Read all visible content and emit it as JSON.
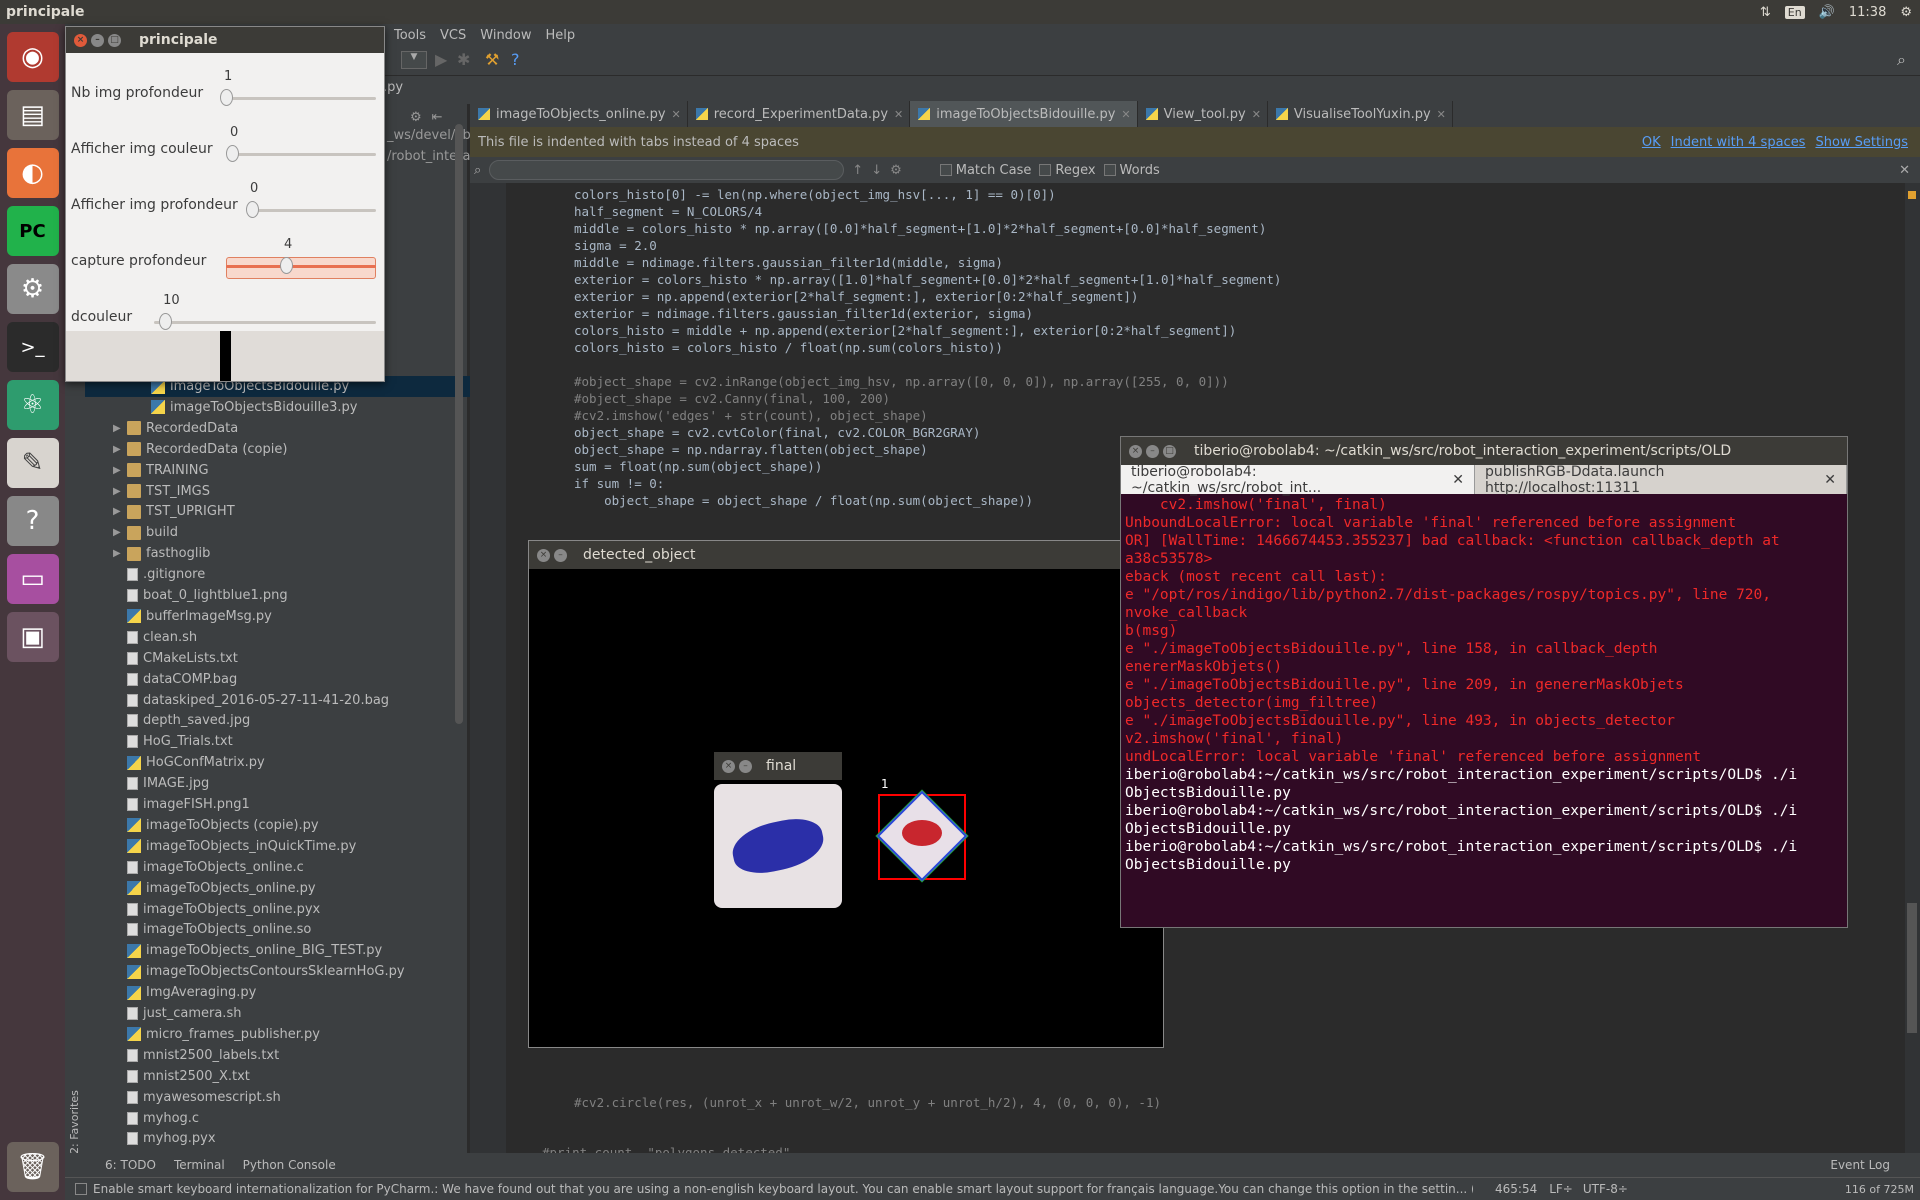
{
  "top_panel": {
    "title": "principale",
    "lang": "En",
    "time": "11:38"
  },
  "menubar": {
    "items": [
      "Tools",
      "VCS",
      "Window",
      "Help"
    ]
  },
  "navbar": {
    "crumb_file": ".py",
    "crumb_path1": "_ws/devel/lib",
    "crumb_path2": "/robot_intera"
  },
  "editor_tabs": [
    {
      "label": "imageToObjects_online.py",
      "active": false
    },
    {
      "label": "record_ExperimentData.py",
      "active": false
    },
    {
      "label": "imageToObjectsBidouille.py",
      "active": true
    },
    {
      "label": "View_tool.py",
      "active": false
    },
    {
      "label": "VisualiseToolYuxin.py",
      "active": false
    }
  ],
  "notice": {
    "text": "This file is indented with tabs instead of 4 spaces",
    "ok": "OK",
    "indent": "Indent with 4 spaces",
    "settings": "Show Settings"
  },
  "search": {
    "match_case": "Match Case",
    "regex": "Regex",
    "words": "Words"
  },
  "code_lines": [
    {
      "text": "colors_histo[0] -= len(np.where(object_img_hsv[..., 1] == 0)[0])",
      "cm": false
    },
    {
      "text": "half_segment = N_COLORS/4",
      "cm": false
    },
    {
      "text": "middle = colors_histo * np.array([0.0]*half_segment+[1.0]*2*half_segment+[0.0]*half_segment)",
      "cm": false
    },
    {
      "text": "sigma = 2.0",
      "cm": false
    },
    {
      "text": "middle = ndimage.filters.gaussian_filter1d(middle, sigma)",
      "cm": false
    },
    {
      "text": "exterior = colors_histo * np.array([1.0]*half_segment+[0.0]*2*half_segment+[1.0]*half_segment)",
      "cm": false
    },
    {
      "text": "exterior = np.append(exterior[2*half_segment:], exterior[0:2*half_segment])",
      "cm": false
    },
    {
      "text": "exterior = ndimage.filters.gaussian_filter1d(exterior, sigma)",
      "cm": false
    },
    {
      "text": "colors_histo = middle + np.append(exterior[2*half_segment:], exterior[0:2*half_segment])",
      "cm": false
    },
    {
      "text": "colors_histo = colors_histo / float(np.sum(colors_histo))",
      "cm": false
    },
    {
      "text": "",
      "cm": false
    },
    {
      "text": "#object_shape = cv2.inRange(object_img_hsv, np.array([0, 0, 0]), np.array([255, 0, 0]))",
      "cm": true
    },
    {
      "text": "#object_shape = cv2.Canny(final, 100, 200)",
      "cm": true
    },
    {
      "text": "#cv2.imshow('edges' + str(count), object_shape)",
      "cm": true
    },
    {
      "text": "object_shape = cv2.cvtColor(final, cv2.COLOR_BGR2GRAY)",
      "cm": false
    },
    {
      "text": "object_shape = np.ndarray.flatten(object_shape)",
      "cm": false
    },
    {
      "text": "sum = float(np.sum(object_shape))",
      "cm": false
    },
    {
      "text": "if sum != 0:",
      "cm": false
    },
    {
      "text": "    object_shape = object_shape / float(np.sum(object_shape))",
      "cm": false
    }
  ],
  "code_bottom": {
    "line1": "#cv2.circle(res, (unrot_x + unrot_w/2, unrot_y + unrot_h/2), 4, (0, 0, 0), -1)",
    "line2": "#print count, \"polygons detected\""
  },
  "project_tree": [
    {
      "label": "imageToObjectsBidouille.py",
      "type": "py",
      "indent": 2,
      "selected": true
    },
    {
      "label": "imageToObjectsBidouille3.py",
      "type": "py",
      "indent": 2
    },
    {
      "label": "RecordedData",
      "type": "dir",
      "indent": 1
    },
    {
      "label": "RecordedData (copie)",
      "type": "dir",
      "indent": 1
    },
    {
      "label": "TRAINING",
      "type": "dir",
      "indent": 1
    },
    {
      "label": "TST_IMGS",
      "type": "dir",
      "indent": 1
    },
    {
      "label": "TST_UPRIGHT",
      "type": "dir",
      "indent": 1
    },
    {
      "label": "build",
      "type": "dir",
      "indent": 1
    },
    {
      "label": "fasthoglib",
      "type": "dir",
      "indent": 1
    },
    {
      "label": ".gitignore",
      "type": "file",
      "indent": 1
    },
    {
      "label": "boat_0_lightblue1.png",
      "type": "file",
      "indent": 1
    },
    {
      "label": "bufferImageMsg.py",
      "type": "py",
      "indent": 1
    },
    {
      "label": "clean.sh",
      "type": "file",
      "indent": 1
    },
    {
      "label": "CMakeLists.txt",
      "type": "file",
      "indent": 1
    },
    {
      "label": "dataCOMP.bag",
      "type": "file",
      "indent": 1
    },
    {
      "label": "dataskiped_2016-05-27-11-41-20.bag",
      "type": "file",
      "indent": 1
    },
    {
      "label": "depth_saved.jpg",
      "type": "file",
      "indent": 1
    },
    {
      "label": "HoG_Trials.txt",
      "type": "file",
      "indent": 1
    },
    {
      "label": "HoGConfMatrix.py",
      "type": "py",
      "indent": 1
    },
    {
      "label": "IMAGE.jpg",
      "type": "file",
      "indent": 1
    },
    {
      "label": "imageFISH.png1",
      "type": "file",
      "indent": 1
    },
    {
      "label": "imageToObjects (copie).py",
      "type": "py",
      "indent": 1
    },
    {
      "label": "imageToObjects_inQuickTime.py",
      "type": "py",
      "indent": 1
    },
    {
      "label": "imageToObjects_online.c",
      "type": "file",
      "indent": 1
    },
    {
      "label": "imageToObjects_online.py",
      "type": "py",
      "indent": 1
    },
    {
      "label": "imageToObjects_online.pyx",
      "type": "file",
      "indent": 1
    },
    {
      "label": "imageToObjects_online.so",
      "type": "file",
      "indent": 1
    },
    {
      "label": "imageToObjects_online_BIG_TEST.py",
      "type": "py",
      "indent": 1
    },
    {
      "label": "imageToObjectsContoursSklearnHoG.py",
      "type": "py",
      "indent": 1
    },
    {
      "label": "ImgAveraging.py",
      "type": "py",
      "indent": 1
    },
    {
      "label": "just_camera.sh",
      "type": "file",
      "indent": 1
    },
    {
      "label": "micro_frames_publisher.py",
      "type": "py",
      "indent": 1
    },
    {
      "label": "mnist2500_labels.txt",
      "type": "file",
      "indent": 1
    },
    {
      "label": "mnist2500_X.txt",
      "type": "file",
      "indent": 1
    },
    {
      "label": "myawesomescript.sh",
      "type": "file",
      "indent": 1
    },
    {
      "label": "myhog.c",
      "type": "file",
      "indent": 1
    },
    {
      "label": "myhog.pyx",
      "type": "file",
      "indent": 1
    }
  ],
  "favorites_label": "2: Favorites",
  "principale": {
    "title": "principale",
    "sliders": [
      {
        "label": "Nb img profondeur",
        "value": "1",
        "level": 0.0
      },
      {
        "label": "Afficher img couleur",
        "value": "0",
        "level": 0.0
      },
      {
        "label": "Afficher img profondeur",
        "value": "0",
        "level": 0.0
      },
      {
        "label": "capture profondeur",
        "value": "4",
        "level": 0.4
      },
      {
        "label": "dcouleur",
        "value": "10",
        "level": 0.05
      }
    ]
  },
  "detected_object": {
    "title": "detected_object",
    "label": "1"
  },
  "final_window": {
    "title": "final"
  },
  "terminal": {
    "title": "tiberio@robolab4: ~/catkin_ws/src/robot_interaction_experiment/scripts/OLD",
    "tab1": "tiberio@robolab4: ~/catkin_ws/src/robot_int...",
    "tab2": "publishRGB-Ddata.launch http://localhost:11311",
    "lines": [
      {
        "text": "    cv2.imshow('final', final)",
        "color": "red"
      },
      {
        "text": "UnboundLocalError: local variable 'final' referenced before assignment",
        "color": "red"
      },
      {
        "text": "",
        "color": "red"
      },
      {
        "text": "OR] [WallTime: 1466674453.355237] bad callback: <function callback_depth at",
        "color": "red"
      },
      {
        "text": "a38c53578>",
        "color": "red"
      },
      {
        "text": "eback (most recent call last):",
        "color": "red"
      },
      {
        "text": "e \"/opt/ros/indigo/lib/python2.7/dist-packages/rospy/topics.py\", line 720,",
        "color": "red"
      },
      {
        "text": "nvoke_callback",
        "color": "red"
      },
      {
        "text": "b(msg)",
        "color": "red"
      },
      {
        "text": "e \"./imageToObjectsBidouille.py\", line 158, in callback_depth",
        "color": "red"
      },
      {
        "text": "enererMaskObjets()",
        "color": "red"
      },
      {
        "text": "e \"./imageToObjectsBidouille.py\", line 209, in genererMaskObjets",
        "color": "red"
      },
      {
        "text": "objects_detector(img_filtree)",
        "color": "red"
      },
      {
        "text": "e \"./imageToObjectsBidouille.py\", line 493, in objects_detector",
        "color": "red"
      },
      {
        "text": "v2.imshow('final', final)",
        "color": "red"
      },
      {
        "text": "undLocalError: local variable 'final' referenced before assignment",
        "color": "red"
      },
      {
        "text": "",
        "color": "white"
      },
      {
        "text": "iberio@robolab4:~/catkin_ws/src/robot_interaction_experiment/scripts/OLD$ ./i",
        "color": "white"
      },
      {
        "text": "ObjectsBidouille.py",
        "color": "white"
      },
      {
        "text": "iberio@robolab4:~/catkin_ws/src/robot_interaction_experiment/scripts/OLD$ ./i",
        "color": "white"
      },
      {
        "text": "ObjectsBidouille.py",
        "color": "white"
      },
      {
        "text": "iberio@robolab4:~/catkin_ws/src/robot_interaction_experiment/scripts/OLD$ ./i",
        "color": "white"
      },
      {
        "text": "ObjectsBidouille.py",
        "color": "white"
      }
    ]
  },
  "toolwindows": {
    "todo": "6: TODO",
    "terminal": "Terminal",
    "python_console": "Python Console",
    "event_log": "Event Log"
  },
  "statusbar": {
    "message": "Enable smart keyboard internationalization for PyCharm.: We have found out that you are using a non-english keyboard layout. You can enable smart layout support for français language.You can change this option in the settin... (today 09:37)",
    "position": "465:54",
    "line_sep": "LF÷",
    "encoding": "UTF-8÷",
    "memory": "116 of 725M"
  },
  "colors": {
    "accent": "#589df6",
    "terminal_bg": "#300a24",
    "error": "#ef2929",
    "launcher_bg": "#45373d"
  }
}
